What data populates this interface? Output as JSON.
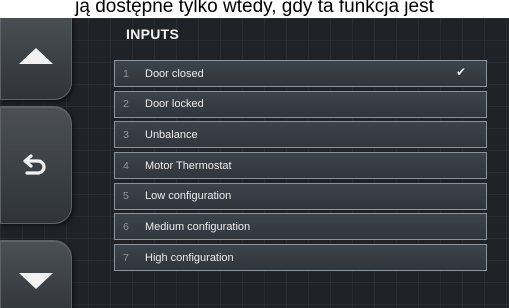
{
  "caption": "ją dostępne tylko wtedy, gdy ta funkcja jest",
  "panel": {
    "title": "INPUTS"
  },
  "inputs": [
    {
      "num": "1",
      "label": "Door closed",
      "check": "✔"
    },
    {
      "num": "2",
      "label": "Door locked",
      "check": ""
    },
    {
      "num": "3",
      "label": "Unbalance",
      "check": ""
    },
    {
      "num": "4",
      "label": "Motor Thermostat",
      "check": ""
    },
    {
      "num": "5",
      "label": "Low configuration",
      "check": ""
    },
    {
      "num": "6",
      "label": "Medium configuration",
      "check": ""
    },
    {
      "num": "7",
      "label": "High configuration",
      "check": ""
    }
  ],
  "icons": {
    "up": "arrow-up-icon",
    "back": "back-icon",
    "down": "arrow-down-icon"
  }
}
